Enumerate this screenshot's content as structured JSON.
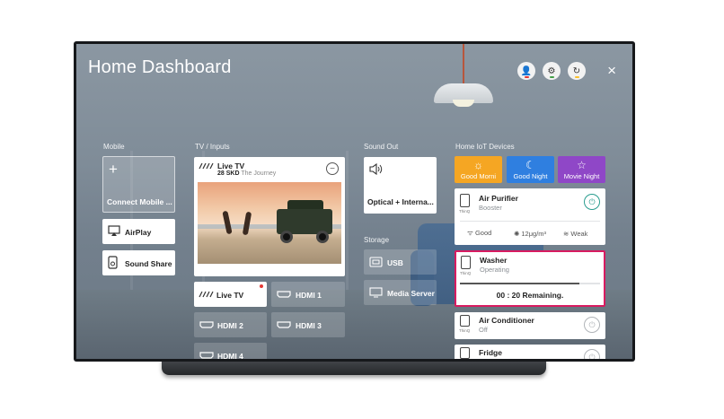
{
  "header": {
    "title": "Home Dashboard",
    "close_glyph": "×"
  },
  "top_icons": [
    {
      "icon": "profile-icon",
      "glyph": "👤",
      "accent": "#e53935"
    },
    {
      "icon": "gear-icon",
      "glyph": "⚙",
      "accent": "#43a047"
    },
    {
      "icon": "refresh-icon",
      "glyph": "↻",
      "accent": "#fbc02d"
    }
  ],
  "sections": {
    "mobile": "Mobile",
    "tv_inputs": "TV / Inputs",
    "sound_out": "Sound Out",
    "storage": "Storage",
    "iot": "Home IoT Devices"
  },
  "mobile": {
    "connect_label": "Connect Mobile ...",
    "airplay_label": "AirPlay",
    "sound_share_label": "Sound Share"
  },
  "live_tv_card": {
    "title": "Live TV",
    "channel": "28 SKD",
    "program": "The Journey"
  },
  "inputs": [
    {
      "label": "Live TV",
      "active": true
    },
    {
      "label": "HDMI 1",
      "active": false
    },
    {
      "label": "HDMI 2",
      "active": false
    },
    {
      "label": "HDMI 3",
      "active": false
    },
    {
      "label": "HDMI 4",
      "active": false
    }
  ],
  "sound_out": {
    "label": "Optical + Interna..."
  },
  "storage": {
    "usb_label": "USB",
    "media_server_label": "Media Server"
  },
  "iot": {
    "scenes": [
      {
        "label": "Good Morni",
        "color": "#f5a623"
      },
      {
        "label": "Good Night",
        "color": "#2f7fe0"
      },
      {
        "label": "Movie Night",
        "color": "#8f47c7"
      }
    ],
    "air_purifier": {
      "name": "Air Purifier",
      "status": "Booster",
      "tag": "ThinQ",
      "quality": "Good",
      "dust": "12μg/m³",
      "fan": "Weak"
    },
    "washer": {
      "name": "Washer",
      "status": "Operating",
      "tag": "ThinQ",
      "remaining": "00 : 20 Remaining.",
      "progress": 0.85
    },
    "air_conditioner": {
      "name": "Air Conditioner",
      "status": "Off",
      "tag": "ThinQ"
    },
    "fridge": {
      "name": "Fridge"
    }
  },
  "colors": {
    "washer_border": "#d81b60",
    "power_on": "#2a9d8f",
    "live_dot": "#e53935"
  }
}
